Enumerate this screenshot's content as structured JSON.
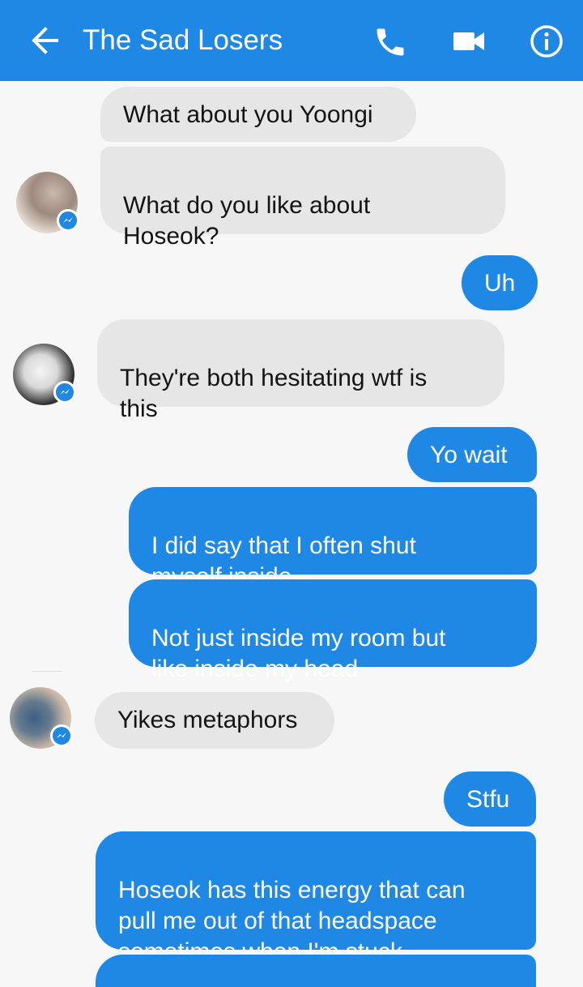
{
  "header": {
    "title": "The Sad Losers",
    "back_icon": "arrow-left-icon",
    "call_icon": "phone-icon",
    "video_icon": "video-camera-icon",
    "info_icon": "info-icon",
    "color": "#1f88e5"
  },
  "messages": [
    {
      "direction": "incoming",
      "text": "What about you Yoongi"
    },
    {
      "direction": "incoming",
      "text": "What do you like about\nHoseok?"
    },
    {
      "direction": "outgoing",
      "text": "Uh"
    },
    {
      "direction": "incoming",
      "text": "They're both hesitating wtf is\nthis"
    },
    {
      "direction": "outgoing",
      "text": "Yo wait"
    },
    {
      "direction": "outgoing",
      "text": "I did say that I often shut\nmyself inside"
    },
    {
      "direction": "outgoing",
      "text": "Not just inside my room but\nlike inside my head"
    },
    {
      "direction": "incoming",
      "text": "Yikes metaphors"
    },
    {
      "direction": "outgoing",
      "text": "Stfu"
    },
    {
      "direction": "outgoing",
      "text": "Hoseok has this energy that can\npull me out of that headspace\nsometimes when I'm stuck"
    }
  ],
  "colors": {
    "incoming_bubble": "#e6e6e6",
    "outgoing_bubble": "#1f88e5",
    "background": "#f7f7f7"
  }
}
